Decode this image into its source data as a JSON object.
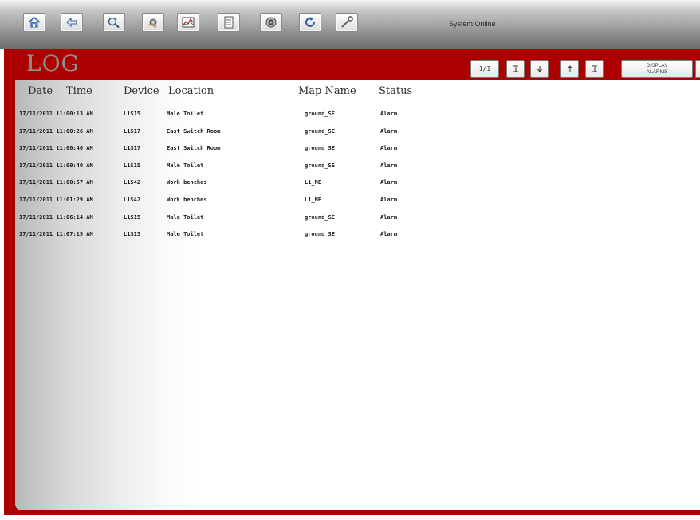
{
  "toolbar": {
    "status_text": "System Online",
    "buttons": [
      {
        "name": "home-button",
        "icon": "home-icon"
      },
      {
        "name": "back-button",
        "icon": "back-arrow-icon"
      },
      {
        "name": "search-button",
        "icon": "magnifier-icon"
      },
      {
        "name": "settings-button",
        "icon": "gear-hand-icon"
      },
      {
        "name": "trend-button",
        "icon": "chart-icon"
      },
      {
        "name": "report-button",
        "icon": "document-icon"
      },
      {
        "name": "speaker-button",
        "icon": "speaker-icon"
      },
      {
        "name": "refresh-button",
        "icon": "refresh-icon"
      },
      {
        "name": "tools-button",
        "icon": "wrench-icon"
      }
    ]
  },
  "log": {
    "title": "LOG",
    "page_indicator": "1/1",
    "display_alarms_line1": "DISPLAY",
    "display_alarms_line2": "ALARMS",
    "headers": {
      "date": "Date",
      "time": "Time",
      "device": "Device",
      "location": "Location",
      "map_name": "Map Name",
      "status": "Status"
    },
    "rows": [
      {
        "datetime": "17/11/2011 11:00:13 AM",
        "device": "L1S15",
        "location": "Male Toilet",
        "map": "ground_SE",
        "status": "Alarm"
      },
      {
        "datetime": "17/11/2011 11:00:26 AM",
        "device": "L1S17",
        "location": "East Switch Room",
        "map": "ground_SE",
        "status": "Alarm"
      },
      {
        "datetime": "17/11/2011 11:00:40 AM",
        "device": "L1S17",
        "location": "East Switch Room",
        "map": "ground_SE",
        "status": "Alarm"
      },
      {
        "datetime": "17/11/2011 11:00:40 AM",
        "device": "L1S15",
        "location": "Male Toilet",
        "map": "ground_SE",
        "status": "Alarm"
      },
      {
        "datetime": "17/11/2011 11:00:57 AM",
        "device": "L1S42",
        "location": "Work benches",
        "map": "L1_NE",
        "status": "Alarm"
      },
      {
        "datetime": "17/11/2011 11:01:29 AM",
        "device": "L1S42",
        "location": "Work benches",
        "map": "L1_NE",
        "status": "Alarm"
      },
      {
        "datetime": "17/11/2011 11:06:14 AM",
        "device": "L1S15",
        "location": "Male Toilet",
        "map": "ground_SE",
        "status": "Alarm"
      },
      {
        "datetime": "17/11/2011 11:07:19 AM",
        "device": "L1S15",
        "location": "Male Toilet",
        "map": "ground_SE",
        "status": "Alarm"
      }
    ]
  },
  "colors": {
    "frame_red": "#ad0000",
    "title_grey": "#8f8f8f"
  }
}
